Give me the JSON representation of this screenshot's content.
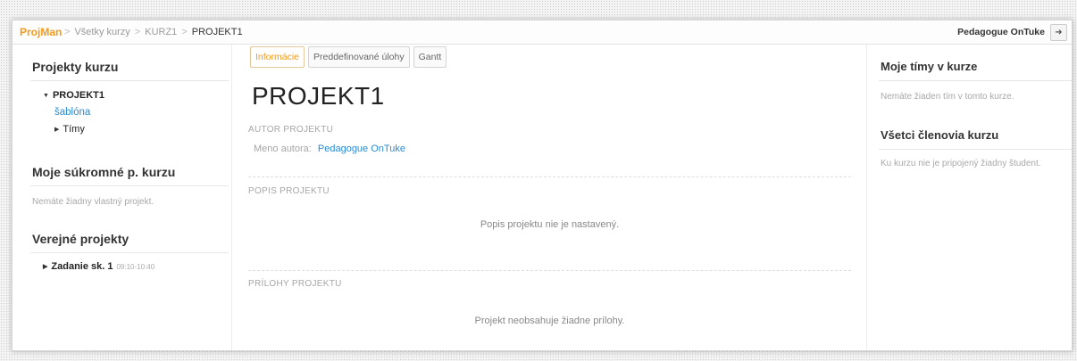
{
  "header": {
    "brand": "ProjMan",
    "breadcrumbs": [
      "Všetky kurzy",
      "KURZ1",
      "PROJEKT1"
    ],
    "user": "Pedagogue OnTuke",
    "logout_icon": "logout-icon"
  },
  "left": {
    "course_projects_title": "Projekty kurzu",
    "tree_project": "PROJEKT1",
    "tree_template": "šablóna",
    "tree_teams": "Tímy",
    "private_title": "Moje súkromné p. kurzu",
    "private_empty": "Nemáte žiadny vlastný projekt.",
    "public_title": "Verejné projekty",
    "public_item": "Zadanie sk. 1",
    "public_item_time": "09:10-10:40"
  },
  "main": {
    "tabs": [
      "Informácie",
      "Preddefinované úlohy",
      "Gantt"
    ],
    "active_tab": "Informácie",
    "project_title": "PROJEKT1",
    "author_section": "AUTOR PROJEKTU",
    "author_label": "Meno autora:",
    "author_name": "Pedagogue OnTuke",
    "description_section": "POPIS PROJEKTU",
    "description_empty": "Popis projektu nie je nastavený.",
    "attachments_section": "PRÍLOHY PROJEKTU",
    "attachments_empty": "Projekt neobsahuje žiadne prílohy."
  },
  "right": {
    "my_teams_title": "Moje tímy v kurze",
    "my_teams_empty": "Nemáte žiaden tím v tomto kurze.",
    "members_title": "Všetci členovia kurzu",
    "members_empty": "Ku kurzu nie je pripojený žiadny študent."
  },
  "colors": {
    "accent": "#f39a1e",
    "link": "#2a8bd1"
  }
}
